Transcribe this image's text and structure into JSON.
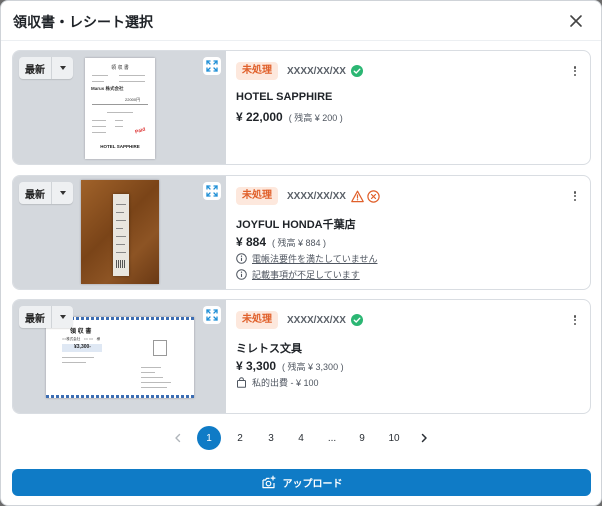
{
  "dialog": {
    "title": "領収書・レシート選択"
  },
  "cards": [
    {
      "sort_label": "最新",
      "status": "未処理",
      "date": "XXXX/XX/XX",
      "store": "HOTEL SAPPHIRE",
      "amount": "¥ 22,000",
      "remain": "( 残高 ¥ 200 )",
      "receipt_text": {
        "heading": "領 収 書",
        "company": "Marus 株式会社",
        "amount_label": "22000円",
        "hotel": "HOTEL SAPPHIRE",
        "stamp": "Paid"
      }
    },
    {
      "sort_label": "最新",
      "status": "未処理",
      "date": "XXXX/XX/XX",
      "store": "JOYFUL HONDA千葉店",
      "amount": "¥ 884",
      "remain": "( 残高 ¥ 884 )",
      "notes": [
        "電帳法要件を満たしていません",
        "記載事項が不足しています"
      ]
    },
    {
      "sort_label": "最新",
      "status": "未処理",
      "date": "XXXX/XX/XX",
      "store": "ミレトス文具",
      "amount": "¥ 3,300",
      "remain": "( 残高 ¥ 3,300 )",
      "private_note": "私的出費 - ¥ 100",
      "receipt_text": {
        "heading": "領 収 書",
        "addressee": "○○株式会社　○○ ○○　様",
        "amount_label": "¥3,300-"
      }
    }
  ],
  "pagination": {
    "pages": [
      "1",
      "2",
      "3",
      "4",
      "...",
      "9",
      "10"
    ],
    "current": "1"
  },
  "upload": {
    "label": "アップロード"
  },
  "colors": {
    "accent": "#0f7bc6",
    "badge_bg": "#fde8dd",
    "badge_text": "#e0602b",
    "ok": "#2bb673",
    "warn": "#e0602b",
    "error": "#e0602b"
  }
}
